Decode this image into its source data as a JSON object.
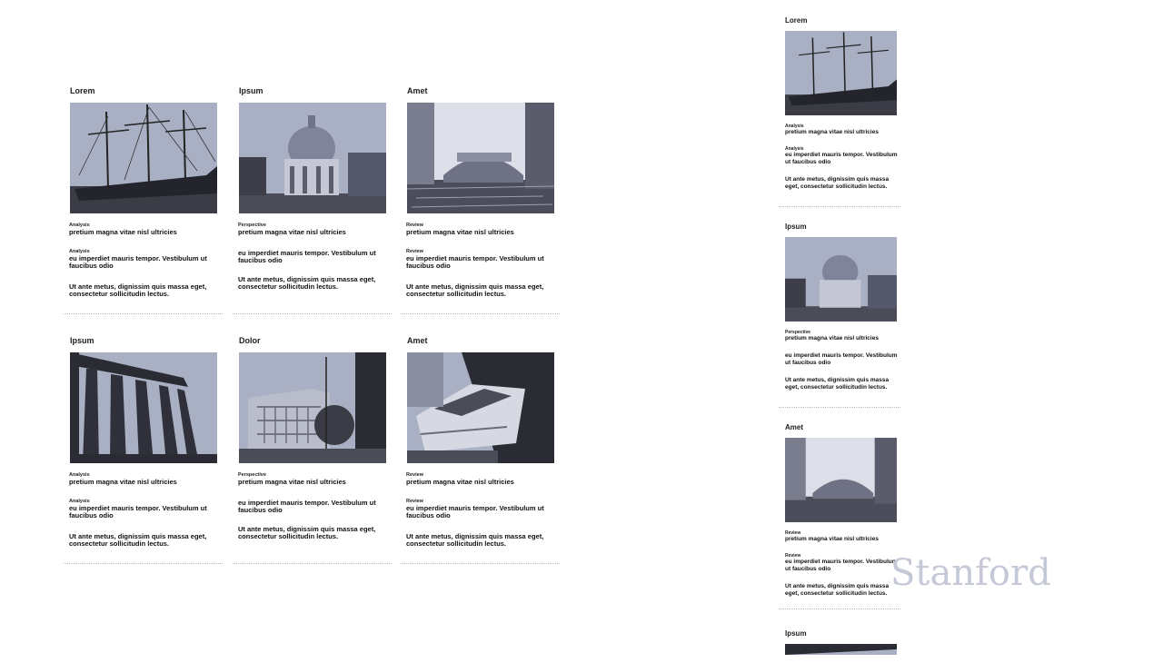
{
  "desktop": {
    "cards": [
      {
        "title": "Lorem",
        "label1": "Analysis",
        "line1": "pretium magna vitae nisl ultricies",
        "label2": "Analysis",
        "line2": "eu imperdiet mauris tempor. Vestibulum ut faucibus odio",
        "line3": "Ut ante metus, dignissim quis massa eget, consectetur sollicitudin lectus.",
        "image": "ship-icon"
      },
      {
        "title": "Ipsum",
        "label1": "Perspective",
        "line1": "pretium magna vitae nisl ultricies",
        "label2": "",
        "line2": "eu imperdiet mauris tempor. Vestibulum ut faucibus odio",
        "line3": "Ut ante metus, dignissim quis massa eget, consectetur sollicitudin lectus.",
        "image": "domed-church-icon"
      },
      {
        "title": "Amet",
        "label1": "Review",
        "line1": "pretium magna vitae nisl ultricies",
        "label2": "Review",
        "line2": "eu imperdiet mauris tempor. Vestibulum ut faucibus odio",
        "line3": "Ut ante metus, dignissim quis massa eget, consectetur sollicitudin lectus.",
        "image": "bridge-icon"
      },
      {
        "title": "Ipsum",
        "label1": "Analysis",
        "line1": "pretium magna vitae nisl ultricies",
        "label2": "Analysis",
        "line2": "eu imperdiet mauris tempor. Vestibulum ut faucibus odio",
        "line3": "Ut ante metus, dignissim quis massa eget, consectetur sollicitudin lectus.",
        "image": "columns-icon"
      },
      {
        "title": "Dolor",
        "label1": "Perspective",
        "line1": "pretium magna vitae nisl ultricies",
        "label2": "",
        "line2": "eu imperdiet mauris tempor. Vestibulum ut faucibus odio",
        "line3": "Ut ante metus, dignissim quis massa eget, consectetur sollicitudin lectus.",
        "image": "colosseum-icon"
      },
      {
        "title": "Amet",
        "label1": "Review",
        "line1": "pretium magna vitae nisl ultricies",
        "label2": "Review",
        "line2": "eu imperdiet mauris tempor. Vestibulum ut faucibus odio",
        "line3": "Ut ante metus, dignissim quis massa eget, consectetur sollicitudin lectus.",
        "image": "train-icon"
      }
    ]
  },
  "mobile": {
    "cards": [
      {
        "title": "Lorem",
        "label1": "Analysis",
        "line1": "pretium magna vitae nisl ultricies",
        "label2": "Analysis",
        "line2": "eu imperdiet mauris tempor. Vestibulum ut faucibus odio",
        "line3": "Ut ante metus, dignissim quis massa eget, consectetur sollicitudin lectus."
      },
      {
        "title": "Ipsum",
        "label1": "Perspective",
        "line1": "pretium magna vitae nisl ultricies",
        "label2": "",
        "line2": "eu imperdiet mauris tempor. Vestibulum ut faucibus odio",
        "line3": "Ut ante metus, dignissim quis massa eget, consectetur sollicitudin lectus."
      },
      {
        "title": "Amet",
        "label1": "Review",
        "line1": "pretium magna vitae nisl ultricies",
        "label2": "Review",
        "line2": "eu imperdiet mauris tempor. Vestibulum ut faucibus odio",
        "line3": "Ut ante metus, dignissim quis massa eget, consectetur sollicitudin lectus."
      },
      {
        "title": "Ipsum"
      }
    ]
  },
  "logo": {
    "text": "Stanford"
  },
  "colors": {
    "sky": "#a9b0c4",
    "dark": "#2a2b33",
    "mid": "#6c6f7e"
  }
}
